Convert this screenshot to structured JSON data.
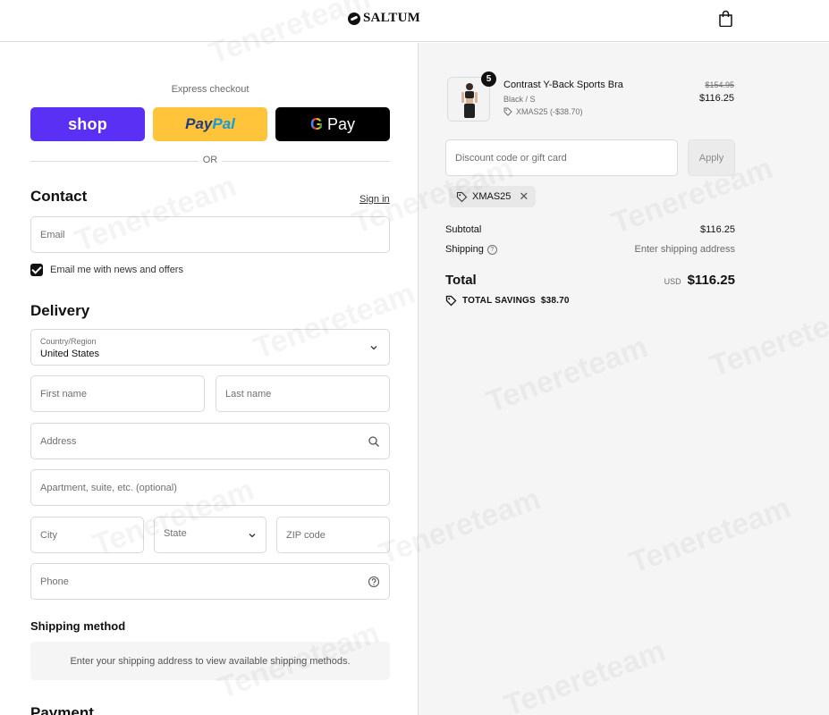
{
  "header": {
    "brand": "SALTUM",
    "cart_icon": "shopping-bag-icon"
  },
  "express": {
    "label": "Express checkout",
    "shop_label": "shop",
    "paypal_part1": "Pay",
    "paypal_part2": "Pal",
    "gpay_g": "G",
    "gpay_label": "Pay",
    "or_label": "OR"
  },
  "contact": {
    "title": "Contact",
    "signin_label": "Sign in",
    "email_placeholder": "Email",
    "newsletter_label": "Email me with news and offers",
    "newsletter_checked": true
  },
  "delivery": {
    "title": "Delivery",
    "country_label": "Country/Region",
    "country_value": "United States",
    "first_name_placeholder": "First name",
    "last_name_placeholder": "Last name",
    "address_placeholder": "Address",
    "apartment_placeholder": "Apartment, suite, etc. (optional)",
    "city_placeholder": "City",
    "state_placeholder": "State",
    "zip_placeholder": "ZIP code",
    "phone_placeholder": "Phone"
  },
  "shipping_method": {
    "title": "Shipping method",
    "message": "Enter your shipping address to view available shipping methods."
  },
  "payment": {
    "title": "Payment"
  },
  "order": {
    "item": {
      "quantity": "5",
      "name": "Contrast Y-Back Sports Bra",
      "variant": "Black / S",
      "discount": "XMAS25 (-$38.70)",
      "price_original": "$154.95",
      "price_final": "$116.25"
    },
    "discount_placeholder": "Discount code or gift card",
    "apply_label": "Apply",
    "applied_code": "XMAS25",
    "subtotal_label": "Subtotal",
    "subtotal_value": "$116.25",
    "shipping_label": "Shipping",
    "shipping_value": "Enter shipping address",
    "total_label": "Total",
    "total_currency": "USD",
    "total_value": "$116.25",
    "savings_label": "TOTAL SAVINGS",
    "savings_value": "$38.70"
  },
  "watermark": "Tenereteam",
  "colors": {
    "shop_purple": "#5a31f4",
    "paypal_yellow": "#ffc439",
    "gpay_black": "#000000",
    "summary_bg": "#f5f5f5"
  }
}
